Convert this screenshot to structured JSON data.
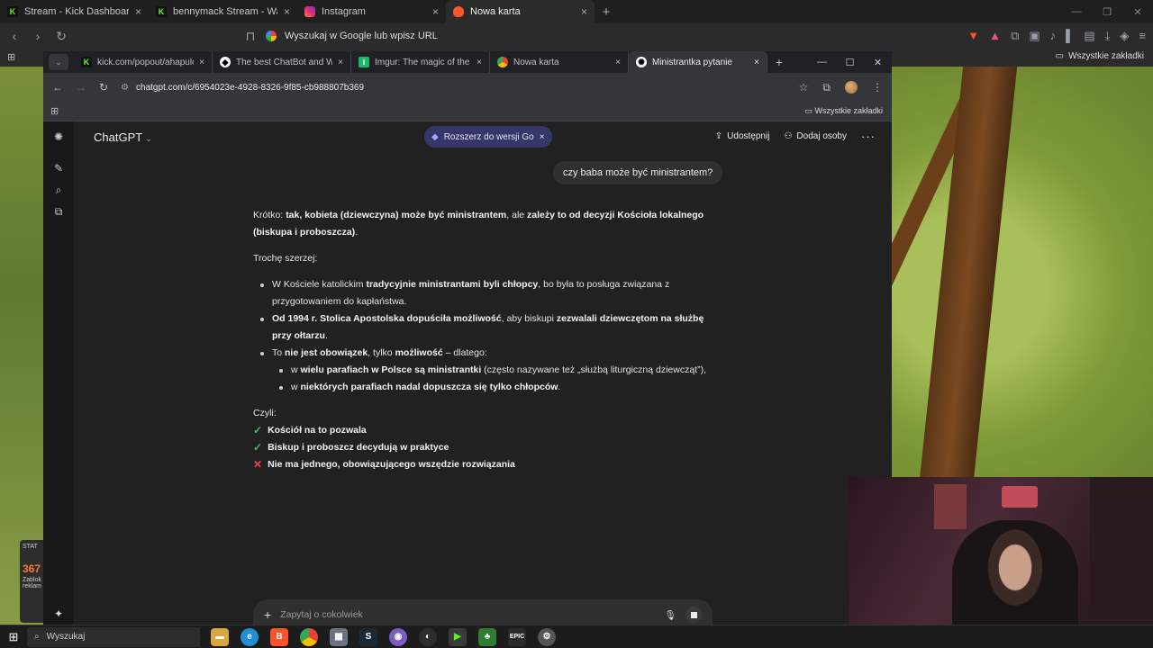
{
  "outer_browser": {
    "tabs": [
      {
        "title": "Stream - Kick Dashboard",
        "favicon": "kick-icon"
      },
      {
        "title": "bennymack Stream - Watch Live on K",
        "favicon": "kick-icon"
      },
      {
        "title": "Instagram",
        "favicon": "instagram-icon"
      },
      {
        "title": "Nowa karta",
        "favicon": "brave-icon"
      }
    ],
    "address_placeholder": "Wyszukaj w Google lub wpisz URL",
    "bookmarks_all": "Wszystkie zakładki"
  },
  "inner_browser": {
    "tabs": [
      {
        "title": "kick.com/popout/ahapulco/ch",
        "favicon": "kick-icon"
      },
      {
        "title": "The best ChatBot and Widget",
        "favicon": "chatbot-icon"
      },
      {
        "title": "Imgur: The magic of the Intern",
        "favicon": "imgur-icon"
      },
      {
        "title": "Nowa karta",
        "favicon": "chrome-icon"
      },
      {
        "title": "Ministrantka pytanie",
        "favicon": "chatgpt-icon"
      }
    ],
    "url": "chatgpt.com/c/6954023e-4928-8326-9f85-cb988807b369",
    "bookmarks_all": "Wszystkie zakładki"
  },
  "chatgpt": {
    "brand": "ChatGPT",
    "upsell": "Rozszerz do wersji Go",
    "share": "Udostępnij",
    "add_people": "Dodaj osoby",
    "user_message": "czy baba może być ministrantem?",
    "answer": {
      "intro_1": "Krótko: ",
      "intro_b1": "tak, kobieta (dziewczyna) może być ministrantem",
      "intro_2": ", ale ",
      "intro_b2": "zależy to od decyzji Kościoła lokalnego (biskupa i proboszcza)",
      "intro_3": ".",
      "more": "Trochę szerzej:",
      "b1_1": "W Kościele katolickim ",
      "b1_b": "tradycyjnie ministrantami byli chłopcy",
      "b1_2": ", bo była to posługa związana z przygotowaniem do kapłaństwa.",
      "b2_b1": "Od 1994 r. Stolica Apostolska dopuściła możliwość",
      "b2_1": ", aby biskupi ",
      "b2_b2": "zezwalali dziewczętom na służbę przy ołtarzu",
      "b2_2": ".",
      "b3_1": "To ",
      "b3_b1": "nie jest obowiązek",
      "b3_2": ", tylko ",
      "b3_b2": "możliwość",
      "b3_3": " – dlatego:",
      "s1_1": "w ",
      "s1_b": "wielu parafiach w Polsce są ministrantki",
      "s1_2": " (często nazywane też „służbą liturgiczną dziewcząt”),",
      "s2_1": "w ",
      "s2_b": "niektórych parafiach nadal dopuszcza się tylko chłopców",
      "s2_2": ".",
      "summary": "Czyli:",
      "c1": "Kościół na to pozwala",
      "c2": "Biskup i proboszcz decydują w praktyce",
      "c3": "Nie ma jednego, obowiązującego wszędzie rozwiązania"
    },
    "composer_placeholder": "Zapytaj o cokolwiek"
  },
  "side_widget": {
    "title": "STAT",
    "number": "367",
    "text1": "Zablok",
    "text2": "reklam"
  },
  "taskbar": {
    "search": "Wyszukaj"
  }
}
